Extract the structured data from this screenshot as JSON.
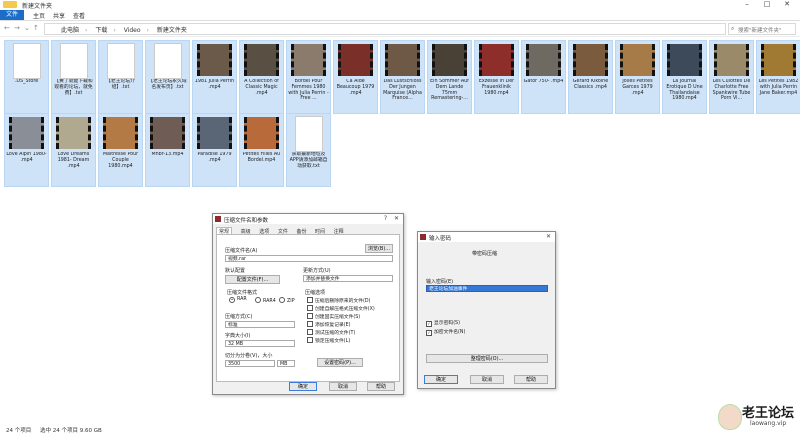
{
  "window": {
    "title": "新建文件夹"
  },
  "ribbon": {
    "tabs": [
      "文件",
      "主页",
      "共享",
      "查看"
    ]
  },
  "address": {
    "crumbs": [
      "此电脑",
      "下载",
      "Video",
      "新建文件夹"
    ]
  },
  "search": {
    "placeholder": "搜索\"新建文件夹\""
  },
  "files": [
    {
      "name": ".DS_Store",
      "kind": "doc"
    },
    {
      "name": "【黄了就能下载和观看的论坛，就免费】.txt",
      "kind": "doc"
    },
    {
      "name": "【老王论坛介绍】.txt",
      "kind": "doc"
    },
    {
      "name": "【老王论坛永久域名发布页】.txt",
      "kind": "doc"
    },
    {
      "name": "1981 Julia Perrin .mp4",
      "kind": "video",
      "color": "#6b5a4a"
    },
    {
      "name": "A Collection of Classic Magic .mp4",
      "kind": "video",
      "color": "#5a4f43"
    },
    {
      "name": "Bordel Pour Femmes 1980 with Julia Perrin - Free ...",
      "kind": "video",
      "color": "#8a7b6d"
    },
    {
      "name": "Ca Aide Beaucoup 1979 .mp4",
      "kind": "video",
      "color": "#7a2f28"
    },
    {
      "name": "Das Lustschloss Der Jungen Marquise (Alpha France...",
      "kind": "video",
      "color": "#6d5945"
    },
    {
      "name": "Ein Sommer Auf Dem Lande 75mm Remastering-...",
      "kind": "video",
      "color": "#494036"
    },
    {
      "name": "Exzesse in Der Frauenklinik 1980.mp4",
      "kind": "video",
      "color": "#8e2e2a"
    },
    {
      "name": "Gator 750- .mp4",
      "kind": "video",
      "color": "#6e6a62"
    },
    {
      "name": "Gerard Kikoine Classics .mp4",
      "kind": "video",
      "color": "#7b5b3d"
    },
    {
      "name": "Jolies Petites Garces 1979 .mp4",
      "kind": "video",
      "color": "#a77b48"
    },
    {
      "name": "La Journal Erotique D Une Thailandaise 1980.mp4",
      "kind": "video",
      "color": "#3d4a5a"
    },
    {
      "name": "Les Culottes De Charlotte Free Spankwire Tube Porn Vi...",
      "kind": "video",
      "color": "#9a8a6a"
    },
    {
      "name": "Les Petites 1982 with Julia Perrin Jane Baker.mp4",
      "kind": "video",
      "color": "#a07a32"
    },
    {
      "name": "Love Alpin 1980- .mp4",
      "kind": "video",
      "color": "#8a8f97"
    },
    {
      "name": "Love Dreams 1981- Dream .mp4",
      "kind": "video",
      "color": "#b1a98f"
    },
    {
      "name": "Maitresse Pour Couple 1980.mp4",
      "kind": "video",
      "color": "#b47a45"
    },
    {
      "name": "Mnbr-13.mp4",
      "kind": "video",
      "color": "#6f5c55"
    },
    {
      "name": "Paradise 1979 .mp4",
      "kind": "video",
      "color": "#5a6675"
    },
    {
      "name": "Petites Filles Au Bordel.mp4",
      "kind": "video",
      "color": "#b86a3a"
    },
    {
      "name": "获取最新地址及APP请添加邮箱自动获取.txt",
      "kind": "doc"
    }
  ],
  "zip_dialog": {
    "title": "压缩文件名和参数",
    "tabs": [
      "常规",
      "高级",
      "选项",
      "文件",
      "备份",
      "时间",
      "注释"
    ],
    "archive_name_label": "压缩文件名(A)",
    "browse_label": "浏览(B)...",
    "archive_name_value": "视频.rar",
    "profile_label": "默认配置",
    "profile_button": "配置文件(F)...",
    "update_mode_label": "更新方式(U)",
    "update_mode_value": "添加并替换文件",
    "format_label": "压缩文件格式",
    "formats": [
      "RAR",
      "RAR4",
      "ZIP"
    ],
    "method_label": "压缩方式(C)",
    "method_value": "标准",
    "dict_label": "字典大小(I)",
    "dict_value": "32 MB",
    "split_label": "切分为分卷(V)，大小",
    "split_value": "3500",
    "split_unit": "MB",
    "options_label": "压缩选项",
    "options": [
      {
        "label": "压缩后删除原来的文件(D)",
        "checked": false
      },
      {
        "label": "创建自解压格式压缩文件(X)",
        "checked": false
      },
      {
        "label": "创建固实压缩文件(S)",
        "checked": false
      },
      {
        "label": "添加恢复记录(E)",
        "checked": false
      },
      {
        "label": "测试压缩的文件(T)",
        "checked": false
      },
      {
        "label": "锁定压缩文件(L)",
        "checked": false
      }
    ],
    "password_button": "设置密码(P)...",
    "ok": "确定",
    "cancel": "取消",
    "help": "帮助"
  },
  "pw_dialog": {
    "title": "输入密码",
    "heading": "带密码压缩",
    "enter_label": "输入密码(E)",
    "password_value": "老王论坛加油事件",
    "show_password": "显示密码(S)",
    "encrypt_names": "加密文件名(N)",
    "organize": "整理密码(O)...",
    "ok": "确定",
    "cancel": "取消",
    "help": "帮助"
  },
  "status": {
    "count": "24 个项目",
    "selected": "选中 24 个项目 9.60 GB"
  },
  "watermark": {
    "name": "老王论坛",
    "site": "laowang.vip"
  }
}
